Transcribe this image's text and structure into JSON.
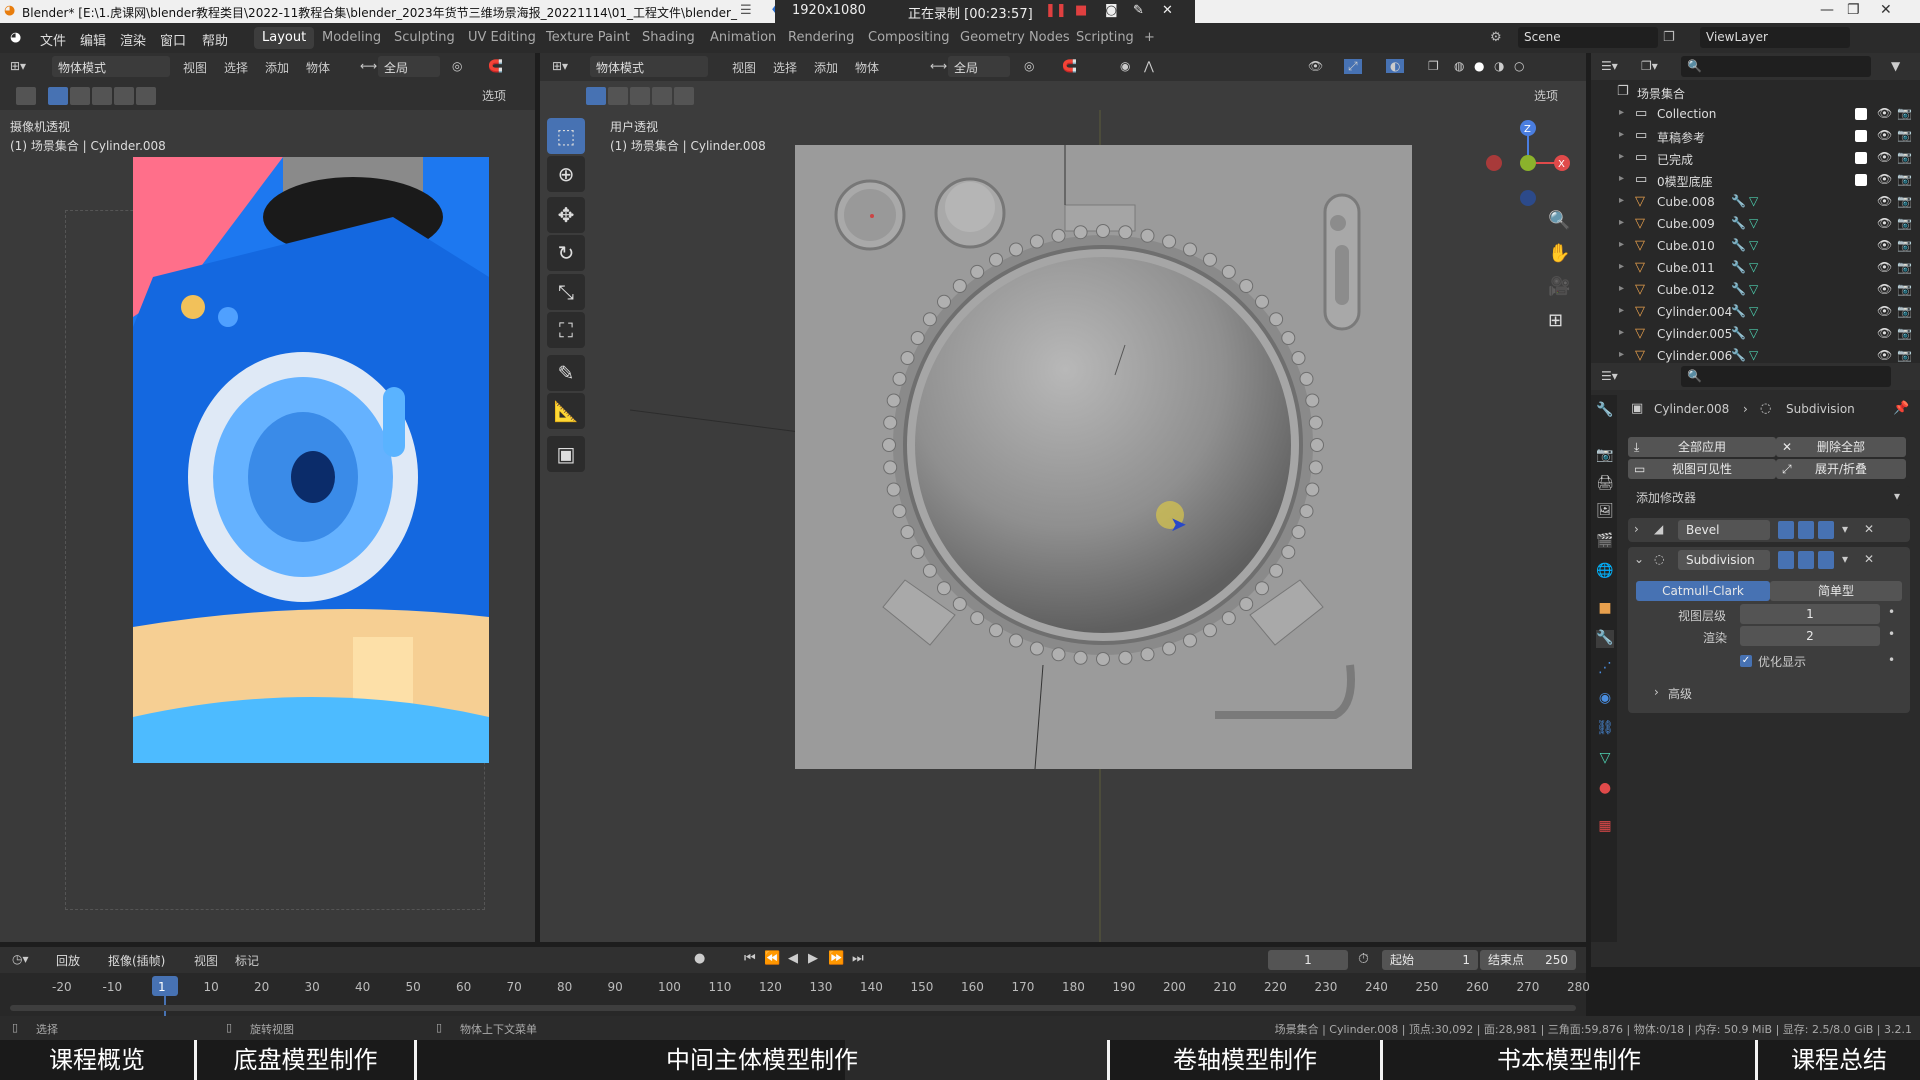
{
  "titlebar": {
    "title": "Blender* [E:\\1.虎课网\\blender教程类目\\2022-11教程合集\\blender_2023年货节三维场景海报_20221114\\01_工程文件\\blender_",
    "resolution": "1920x1080",
    "recording": "正在录制 [00:23:57]"
  },
  "menubar": {
    "file": "文件",
    "edit": "编辑",
    "render": "渲染",
    "window": "窗口",
    "help": "帮助",
    "workspaces": [
      "Layout",
      "Modeling",
      "Sculpting",
      "UV Editing",
      "Texture Paint",
      "Shading",
      "Animation",
      "Rendering",
      "Compositing",
      "Geometry Nodes",
      "Scripting"
    ],
    "active_workspace": "Layout",
    "plus": "+",
    "scene": "Scene",
    "viewlayer": "ViewLayer"
  },
  "left_view": {
    "mode": "物体模式",
    "view": "视图",
    "select": "选择",
    "add": "添加",
    "object": "物体",
    "global": "全局",
    "options": "选项",
    "label": "摄像机透视",
    "context": "(1) 场景集合 | Cylinder.008"
  },
  "main_view": {
    "mode": "物体模式",
    "view": "视图",
    "select": "选择",
    "add": "添加",
    "object": "物体",
    "global": "全局",
    "options": "选项",
    "label": "用户透视",
    "context": "(1) 场景集合 | Cylinder.008"
  },
  "outliner": {
    "root": "场景集合",
    "items": [
      {
        "name": "Collection",
        "type": "collection"
      },
      {
        "name": "草稿参考",
        "type": "collection"
      },
      {
        "name": "已完成",
        "type": "collection"
      },
      {
        "name": "0模型底座",
        "type": "collection"
      },
      {
        "name": "Cube.008",
        "type": "mesh"
      },
      {
        "name": "Cube.009",
        "type": "mesh"
      },
      {
        "name": "Cube.010",
        "type": "mesh"
      },
      {
        "name": "Cube.011",
        "type": "mesh"
      },
      {
        "name": "Cube.012",
        "type": "mesh"
      },
      {
        "name": "Cylinder.004",
        "type": "mesh"
      },
      {
        "name": "Cylinder.005",
        "type": "mesh"
      },
      {
        "name": "Cylinder.006",
        "type": "mesh"
      }
    ]
  },
  "properties": {
    "object": "Cylinder.008",
    "modifier_context": "Subdivision",
    "apply_all": "全部应用",
    "delete_all": "删除全部",
    "viewport_visibility": "视图可见性",
    "expand_collapse": "展开/折叠",
    "add_modifier": "添加修改器",
    "bevel": "Bevel",
    "subdivision": "Subdivision",
    "catmull": "Catmull-Clark",
    "simple": "简单型",
    "levels_viewport_label": "视图层级",
    "levels_viewport": "1",
    "render_label": "渲染",
    "render_levels": "2",
    "optimal_display": "优化显示",
    "advanced": "高级"
  },
  "timeline": {
    "playback": "回放",
    "keying": "抠像(插帧)",
    "view": "视图",
    "marker": "标记",
    "current_frame": "1",
    "start_label": "起始",
    "start": "1",
    "end_label": "结束点",
    "end": "250",
    "ticks": [
      "-20",
      "-10",
      "1",
      "10",
      "20",
      "30",
      "40",
      "50",
      "60",
      "70",
      "80",
      "90",
      "100",
      "110",
      "120",
      "130",
      "140",
      "150",
      "160",
      "170",
      "180",
      "190",
      "200",
      "210",
      "220",
      "230",
      "240",
      "250",
      "260",
      "270",
      "280"
    ]
  },
  "statusbar": {
    "select": "选择",
    "rotate": "旋转视图",
    "context_menu": "物体上下文菜单",
    "stats": "场景集合 | Cylinder.008 | 顶点:30,092 | 面:28,981 | 三角面:59,876 | 物体:0/18 | 内存: 50.9 MiB | 显存: 2.5/8.0 GiB | 3.2.1"
  },
  "chapters": [
    "课程概览",
    "底盘模型制作",
    "中间主体模型制作",
    "卷轴模型制作",
    "书本模型制作",
    "课程总结"
  ],
  "colors": {
    "accent": "#4772b3",
    "object_orange": "#e8a04d"
  }
}
